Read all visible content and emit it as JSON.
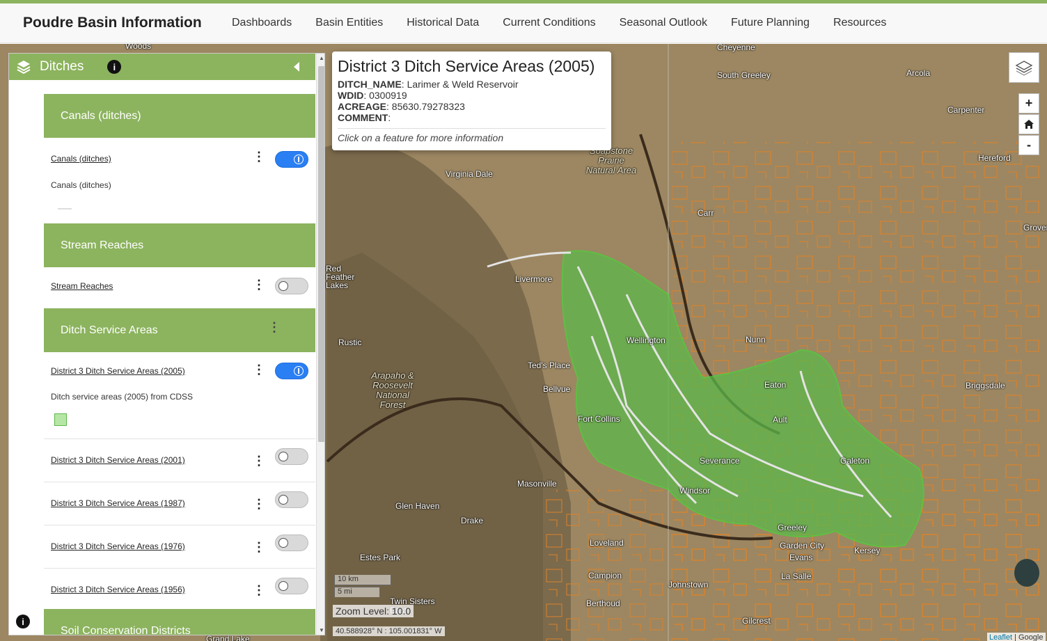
{
  "navbar": {
    "brand": "Poudre Basin Information",
    "items": [
      "Dashboards",
      "Basin Entities",
      "Historical Data",
      "Current Conditions",
      "Seasonal Outlook",
      "Future Planning",
      "Resources"
    ]
  },
  "sidebar": {
    "title": "Ditches",
    "groups": [
      {
        "header": "Canals (ditches)",
        "layers": [
          {
            "name": "Canals (ditches)",
            "enabled": true,
            "description": "Canals (ditches)"
          }
        ]
      },
      {
        "header": "Stream Reaches",
        "layers": [
          {
            "name": "Stream Reaches",
            "enabled": false
          }
        ]
      },
      {
        "header": "Ditch Service Areas",
        "layers": [
          {
            "name": "District 3 Ditch Service Areas (2005)",
            "enabled": true,
            "description": "Ditch service areas (2005) from CDSS"
          },
          {
            "name": "District 3 Ditch Service Areas (2001)",
            "enabled": false
          },
          {
            "name": "District 3 Ditch Service Areas (1987)",
            "enabled": false
          },
          {
            "name": "District 3 Ditch Service Areas (1976)",
            "enabled": false
          },
          {
            "name": "District 3 Ditch Service Areas (1956)",
            "enabled": false
          }
        ]
      },
      {
        "header": "Soil Conservation Districts",
        "layers": []
      }
    ]
  },
  "popup": {
    "title": "District 3 Ditch Service Areas (2005)",
    "fields": [
      {
        "key": "DITCH_NAME",
        "value": "Larimer & Weld Reservoir"
      },
      {
        "key": "WDID",
        "value": "0300919"
      },
      {
        "key": "ACREAGE",
        "value": "85630.79278323"
      },
      {
        "key": "COMMENT",
        "value": ""
      }
    ],
    "hint": "Click on a feature for more information"
  },
  "map_controls": {
    "zoom_in": "+",
    "zoom_out": "-",
    "zoom_level_label": "Zoom Level: 10.0",
    "scale_km": "10 km",
    "scale_mi": "5 mi",
    "coordinates": "40.588928° N : 105.001831° W",
    "attribution_leaflet": "Leaflet",
    "attribution_sep": " | ",
    "attribution_google": "Google"
  },
  "map_labels": [
    "Woods",
    "Cheyenne",
    "South Greeley",
    "Arcola",
    "Carpenter",
    "Hereford",
    "Soapstone Prairie Natural Area",
    "Virginia Dale",
    "Carr",
    "Grover",
    "Red Feather Lakes",
    "Livermore",
    "Wellington",
    "Nunn",
    "Rustic",
    "Arapaho & Roosevelt National Forest",
    "Ted's Place",
    "Bellvue",
    "Fort Collins",
    "Ault",
    "Eaton",
    "Briggsdale",
    "Severance",
    "Galeton",
    "Windsor",
    "Masonville",
    "Glen Haven",
    "Drake",
    "Loveland",
    "Greeley",
    "Garden City",
    "Evans",
    "Kersey",
    "Estes Park",
    "Campion",
    "Johnstown",
    "La Salle",
    "Berthoud",
    "Twin Sisters East",
    "Gilcrest",
    "Grand Lake"
  ],
  "colors": {
    "accent": "#8cb35e",
    "toggle_on": "#2a7ff2",
    "service_area_fill": "#5cb84a",
    "parcel_outline": "#d9822b"
  }
}
